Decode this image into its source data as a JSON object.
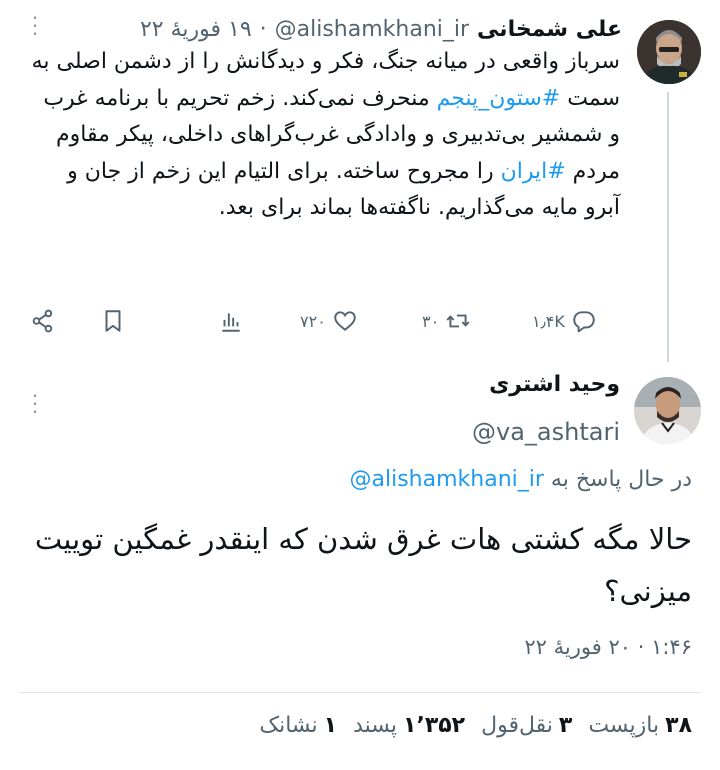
{
  "parent_tweet": {
    "author_name": "علی شمخانی",
    "handle": "@alishamkhani_ir",
    "dot": "·",
    "date": "۱۹ فوریهٔ ۲۲",
    "text_parts": [
      {
        "t": "سرباز واقعی در میانه جنگ، فکر و دیدگانش را از دشمن اصلی به سمت ",
        "tag": false
      },
      {
        "t": "#ستون_پنجم",
        "tag": true
      },
      {
        "t": " منحرف نمی‌کند. زخم تحریم با برنامه غرب و شمشیر بی‌تدبیری و وادادگی غرب‌گراهای داخلی، پیکر مقاوم مردم ",
        "tag": false
      },
      {
        "t": "#ایران",
        "tag": true
      },
      {
        "t": " را مجروح ساخته. برای التیام این زخم از جان و آبرو مایه می‌گذاریم. ناگفته‌ها بماند برای بعد.",
        "tag": false
      }
    ],
    "actions": {
      "replies": "۱٫۴K",
      "retweets": "۳۰",
      "likes": "۷۲۰"
    }
  },
  "reply_tweet": {
    "author_name": "وحید اشتری",
    "handle": "@va_ashtari",
    "replying_to_prefix": "در حال پاسخ به",
    "replying_to_handle": "@alishamkhani_ir",
    "text": "حالا مگه کشتی هات غرق شدن که اینقدر غمگین توییت میزنی؟",
    "time": "۱:۴۶",
    "dot": "·",
    "date": "۲۰ فوریهٔ ۲۲"
  },
  "stats": {
    "retweets_value": "۳۸",
    "retweets_label": "بازپست",
    "quotes_value": "۳",
    "quotes_label": "نقل‌قول",
    "likes_value": "۱٬۳۵۲",
    "likes_label": "پسند",
    "bookmarks_value": "۱",
    "bookmarks_label": "نشانک"
  },
  "colors": {
    "link": "#1d9bf0",
    "secondary": "#536471",
    "primary": "#0f1419"
  },
  "icons": [
    "more-icon",
    "reply-icon",
    "retweet-icon",
    "like-icon",
    "views-icon",
    "bookmark-icon",
    "share-icon"
  ]
}
